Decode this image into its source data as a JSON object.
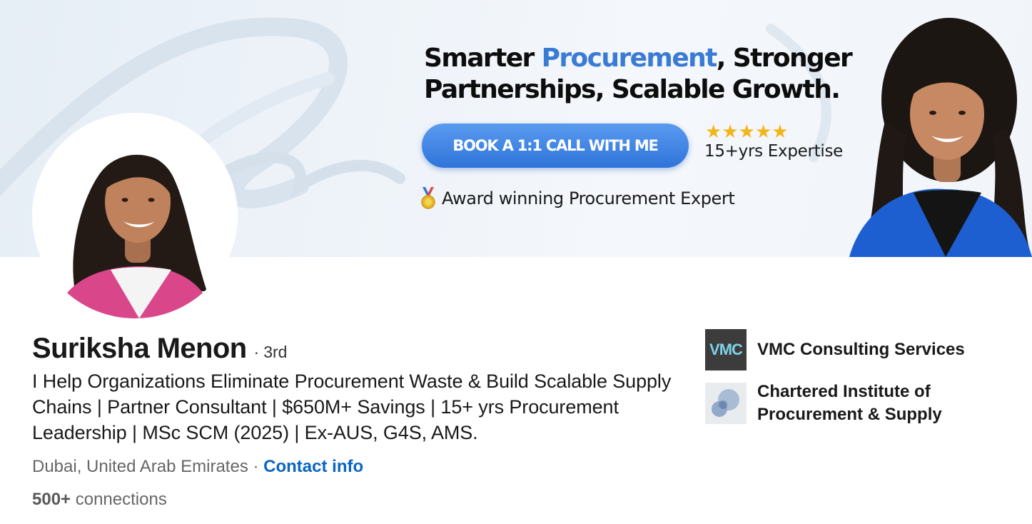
{
  "banner": {
    "headline_pre": "Smarter ",
    "headline_accent": "Procurement",
    "headline_post": ", Stronger",
    "headline_line2": "Partnerships, Scalable Growth.",
    "cta_label": "BOOK A 1:1 CALL WITH ME",
    "rating_stars": 5,
    "expertise": "15+yrs Expertise",
    "award_icon": "medal-icon",
    "award_text": "Award winning Procurement Expert",
    "accent_color": "#3a7bd5",
    "cta_color": "#3b82e6"
  },
  "profile": {
    "name": "Suriksha Menon",
    "degree_separator": "·",
    "degree": "3rd",
    "headline": "I Help Organizations Eliminate Procurement Waste & Build Scalable Supply Chains | Partner Consultant | $650M+ Savings | 15+ yrs Procurement Leadership | MSc SCM (2025) | Ex-AUS, G4S, AMS.",
    "location": "Dubai, United Arab Emirates",
    "location_separator": "·",
    "contact_info_label": "Contact info",
    "connections_count": "500+",
    "connections_label": "connections",
    "link_color": "#0a66c2"
  },
  "organizations": [
    {
      "name": "VMC Consulting Services",
      "logo_icon": "vmc-logo-icon",
      "logo_text": "VMC",
      "logo_color": "#3c3c3c"
    },
    {
      "name_line1": "Chartered Institute of",
      "name_line2": "Procurement & Supply",
      "logo_icon": "cips-logo-icon",
      "logo_color": "#e9ecef"
    }
  ]
}
